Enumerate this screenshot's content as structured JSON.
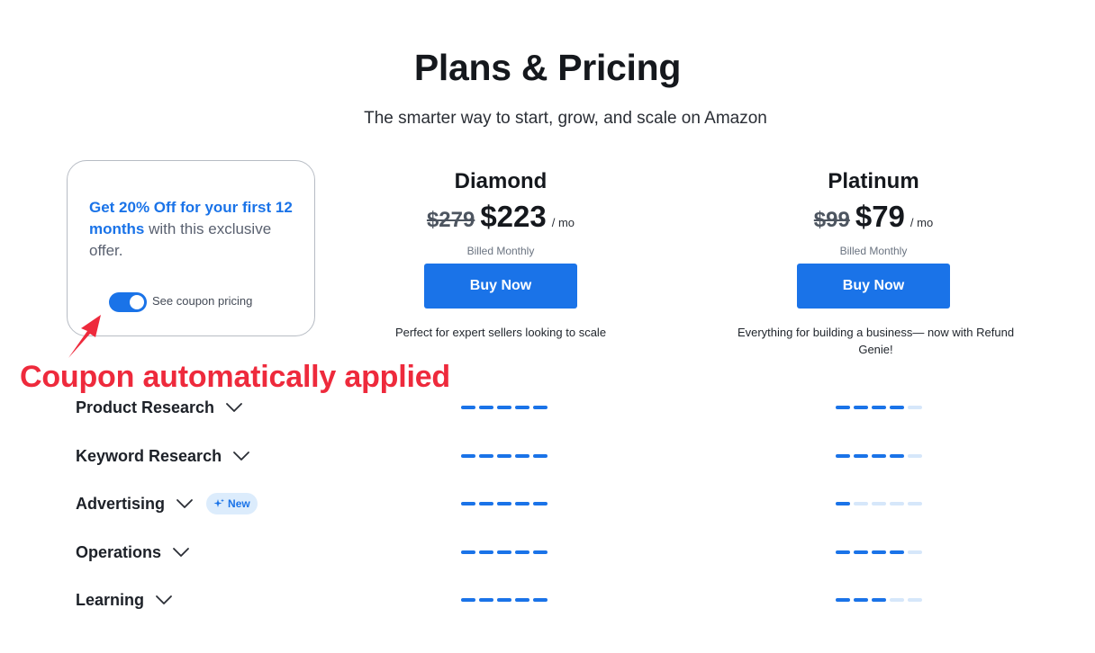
{
  "header": {
    "title": "Plans & Pricing",
    "subtitle": "The smarter way to start, grow, and scale on Amazon"
  },
  "coupon": {
    "highlight": "Get 20% Off for your first 12 months",
    "rest": " with this exclusive offer.",
    "toggle_label": "See coupon pricing",
    "toggle_on": true,
    "accent_color": "#1a73e8"
  },
  "annotation": {
    "text": "Coupon automatically applied",
    "color": "#ee2a3c"
  },
  "plans": [
    {
      "name": "Diamond",
      "old_price": "$279",
      "price": "$223",
      "per": "/ mo",
      "billed": "Billed Monthly",
      "button": "Buy Now",
      "description": "Perfect for expert sellers looking to scale"
    },
    {
      "name": "Platinum",
      "old_price": "$99",
      "price": "$79",
      "per": "/ mo",
      "billed": "Billed Monthly",
      "button": "Buy Now",
      "description": "Everything for building a business— now with Refund Genie!"
    }
  ],
  "features": [
    {
      "label": "Product Research",
      "badge": null,
      "levels": [
        5,
        4
      ]
    },
    {
      "label": "Keyword Research",
      "badge": null,
      "levels": [
        5,
        4
      ]
    },
    {
      "label": "Advertising",
      "badge": "New",
      "levels": [
        5,
        1
      ]
    },
    {
      "label": "Operations",
      "badge": null,
      "levels": [
        5,
        4
      ]
    },
    {
      "label": "Learning",
      "badge": null,
      "levels": [
        5,
        3
      ]
    }
  ],
  "bar_max": 5,
  "icons": {
    "chevron": "chevron-down-icon",
    "sparkle": "sparkle-icon",
    "arrow": "arrow-annotation-icon"
  }
}
